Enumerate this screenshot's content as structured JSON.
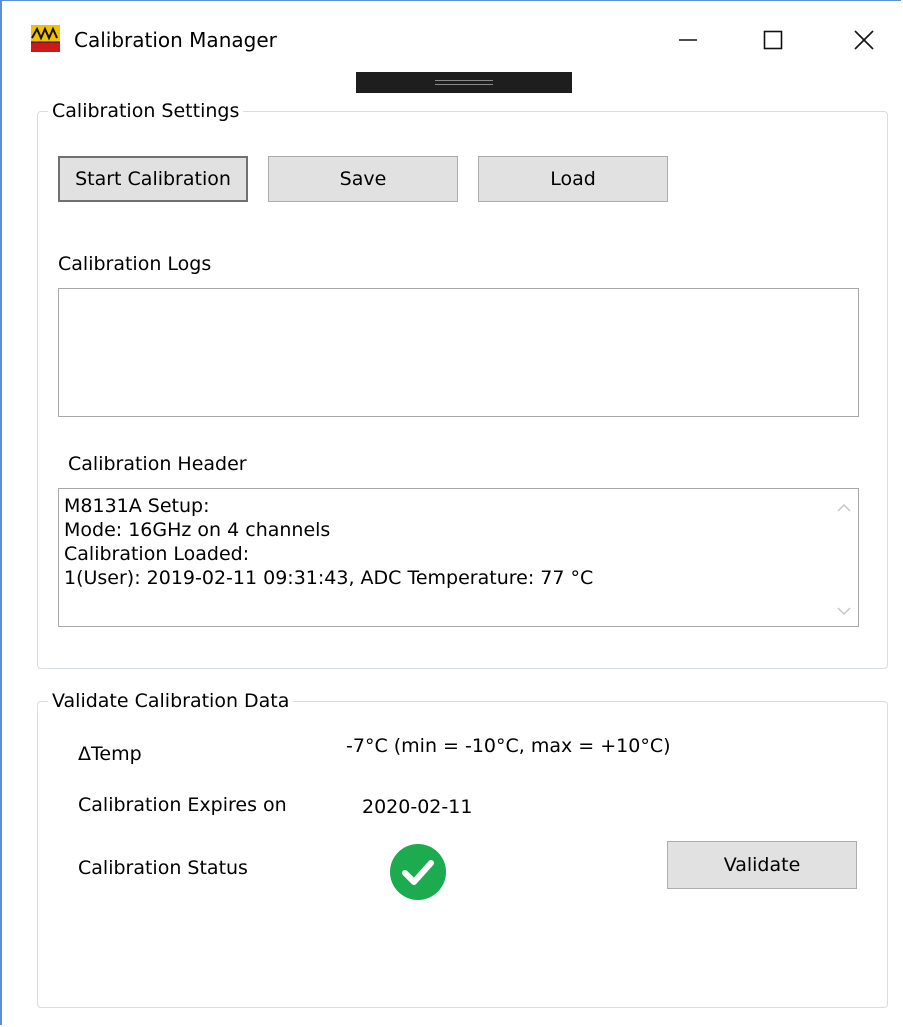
{
  "window": {
    "title": "Calibration Manager",
    "controls": {
      "minimize_icon": "minimize-icon",
      "maximize_icon": "maximize-icon",
      "close_icon": "close-icon"
    }
  },
  "settings_group": {
    "legend": "Calibration Settings",
    "buttons": {
      "start": "Start Calibration",
      "save": "Save",
      "load": "Load"
    },
    "logs_label": "Calibration Logs",
    "logs_value": "",
    "header_label": "Calibration Header",
    "header_lines": [
      "M8131A Setup:",
      "Mode: 16GHz on 4 channels",
      "Calibration Loaded:",
      "1(User): 2019-02-11 09:31:43, ADC Temperature: 77 °C"
    ]
  },
  "validate_group": {
    "legend": "Validate Calibration Data",
    "delta_temp_label": "ΔTemp",
    "delta_temp_value": "-7°C (min = -10°C, max = +10°C)",
    "expires_label": "Calibration Expires on",
    "expires_value": "2020-02-11",
    "status_label": "Calibration Status",
    "status_icon": "check-circle-icon",
    "status_color": "#1cab4f",
    "validate_button": "Validate"
  }
}
